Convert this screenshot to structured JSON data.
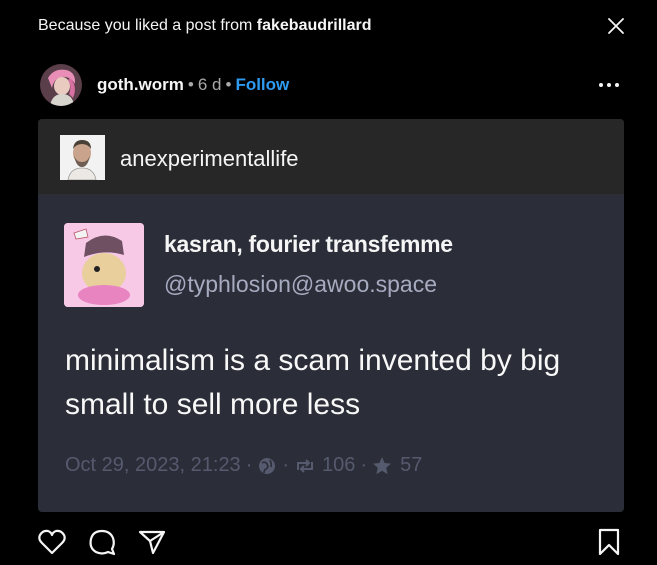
{
  "banner": {
    "prefix": "Because you liked a post from ",
    "source_account": "fakebaudrillard"
  },
  "post": {
    "username": "goth.worm",
    "separator": "•",
    "age": "6 d",
    "follow_label": "Follow"
  },
  "media": {
    "reblog_account": "anexperimentallife",
    "toot": {
      "display_name": "kasran, fourier transfemme",
      "handle": "@typhlosion@awoo.space",
      "text": "minimalism is a scam invented by big small to sell more less",
      "timestamp": "Oct 29, 2023, 21:23",
      "meta_sep": "·",
      "boosts": "106",
      "favourites": "57"
    }
  },
  "colors": {
    "background": "#000000",
    "accent_link": "#2e9bf0",
    "media_bg": "#2b2d38",
    "media_header_bg": "#272727"
  },
  "icons": {
    "close": "close-icon",
    "more": "more-icon",
    "like": "heart-icon",
    "comment": "comment-icon",
    "share": "share-icon",
    "save": "bookmark-icon"
  }
}
